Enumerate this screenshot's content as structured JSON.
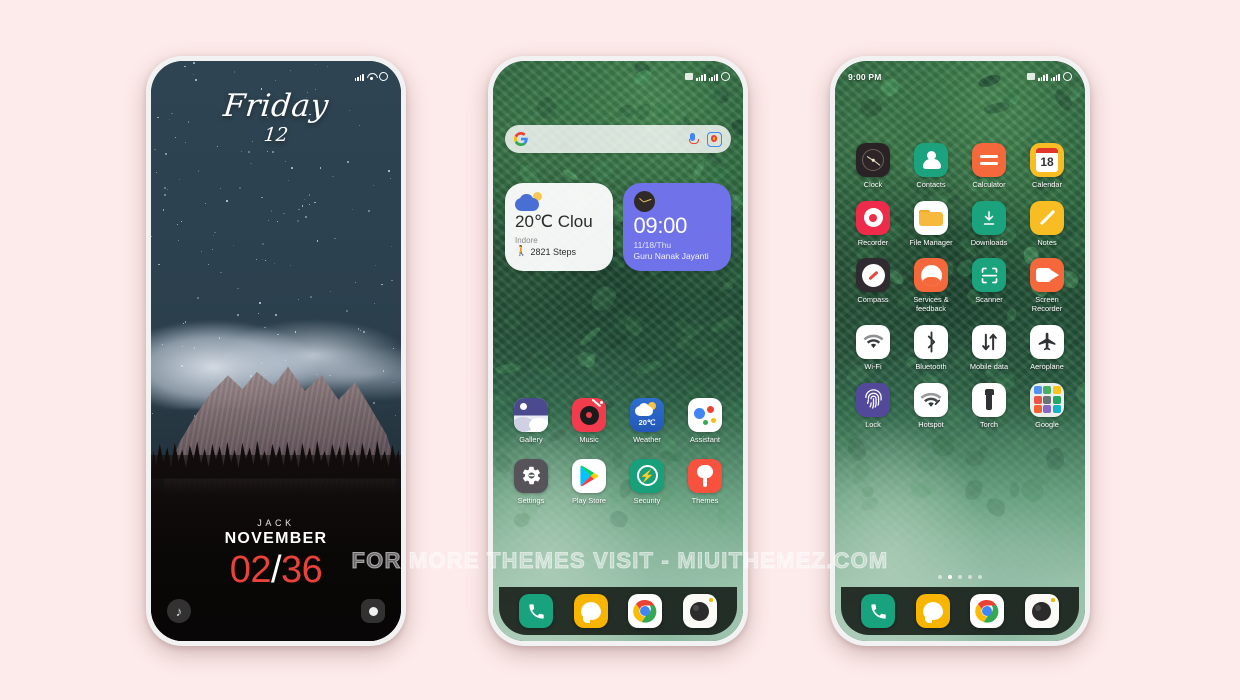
{
  "background_color": "#fdeaea",
  "watermark": "FOR MORE THEMES VISIT - MIUITHEMEZ.COM",
  "lockscreen": {
    "status": {
      "signal": "signal-bars",
      "wifi": "wifi-icon",
      "battery": "battery-circle"
    },
    "day": "Friday",
    "date": "12",
    "name": "JACK",
    "month": "NOVEMBER",
    "time_left": "02",
    "time_sep": "/",
    "time_right": "36",
    "shortcut_left": "music-note-icon",
    "shortcut_right": "camera-icon"
  },
  "homescreen": {
    "status": {
      "sim": "sim-icon",
      "signal": "signal-bars",
      "battery": "battery-circle"
    },
    "search": {
      "logo": "google-g-icon",
      "mic": "microphone-icon",
      "lens": "google-lens-icon",
      "placeholder": ""
    },
    "weather_widget": {
      "icon": "partly-cloudy-icon",
      "temp": "20℃ Clou",
      "city": "Indore",
      "steps_icon": "walking-icon",
      "steps": "2821 Steps"
    },
    "clock_widget": {
      "icon": "analog-clock-icon",
      "time": "09:00",
      "date": "11/18/Thu",
      "festival": "Guru Nanak Jayanti"
    },
    "apps": [
      {
        "label": "Gallery",
        "icon": "gallery-icon"
      },
      {
        "label": "Music",
        "icon": "music-icon"
      },
      {
        "label": "Weather",
        "icon": "weather-icon",
        "badge": "20℃"
      },
      {
        "label": "Assistant",
        "icon": "assistant-icon"
      },
      {
        "label": "Settings",
        "icon": "settings-icon"
      },
      {
        "label": "Play Store",
        "icon": "play-store-icon"
      },
      {
        "label": "Security",
        "icon": "security-icon"
      },
      {
        "label": "Themes",
        "icon": "themes-icon"
      }
    ],
    "dock": [
      {
        "label": "Phone",
        "icon": "phone-icon"
      },
      {
        "label": "Messages",
        "icon": "messages-icon"
      },
      {
        "label": "Chrome",
        "icon": "chrome-icon"
      },
      {
        "label": "Camera",
        "icon": "camera-icon"
      }
    ]
  },
  "appdrawer": {
    "status": {
      "time": "9:00 PM",
      "sim": "sim-icon",
      "signal": "signal-bars",
      "battery": "battery-circle"
    },
    "apps": [
      {
        "label": "Clock",
        "icon": "clock-icon"
      },
      {
        "label": "Contacts",
        "icon": "contacts-icon"
      },
      {
        "label": "Calculator",
        "icon": "calculator-icon"
      },
      {
        "label": "Calendar",
        "icon": "calendar-icon",
        "day": "18"
      },
      {
        "label": "Recorder",
        "icon": "recorder-icon"
      },
      {
        "label": "File Manager",
        "icon": "file-manager-icon"
      },
      {
        "label": "Downloads",
        "icon": "downloads-icon"
      },
      {
        "label": "Notes",
        "icon": "notes-icon"
      },
      {
        "label": "Compass",
        "icon": "compass-icon"
      },
      {
        "label": "Services & feedback",
        "icon": "services-feedback-icon"
      },
      {
        "label": "Scanner",
        "icon": "scanner-icon"
      },
      {
        "label": "Screen Recorder",
        "icon": "screen-recorder-icon"
      },
      {
        "label": "Wi-Fi",
        "icon": "wifi-icon"
      },
      {
        "label": "Bluetooth",
        "icon": "bluetooth-icon"
      },
      {
        "label": "Mobile data",
        "icon": "mobile-data-icon"
      },
      {
        "label": "Aeroplane",
        "icon": "aeroplane-icon"
      },
      {
        "label": "Lock",
        "icon": "fingerprint-icon"
      },
      {
        "label": "Hotspot",
        "icon": "hotspot-icon"
      },
      {
        "label": "Torch",
        "icon": "torch-icon"
      },
      {
        "label": "Google",
        "icon": "google-folder-icon"
      }
    ],
    "page_dots": {
      "count": 5,
      "active_index": 1
    },
    "dock": [
      {
        "label": "Phone",
        "icon": "phone-icon"
      },
      {
        "label": "Messages",
        "icon": "messages-icon"
      },
      {
        "label": "Chrome",
        "icon": "chrome-icon"
      },
      {
        "label": "Camera",
        "icon": "camera-icon"
      }
    ]
  },
  "colors": {
    "accent_red": "#e8423a",
    "widget_blue": "#6f72e8",
    "dock_bg": "rgba(8,14,10,.82)"
  }
}
